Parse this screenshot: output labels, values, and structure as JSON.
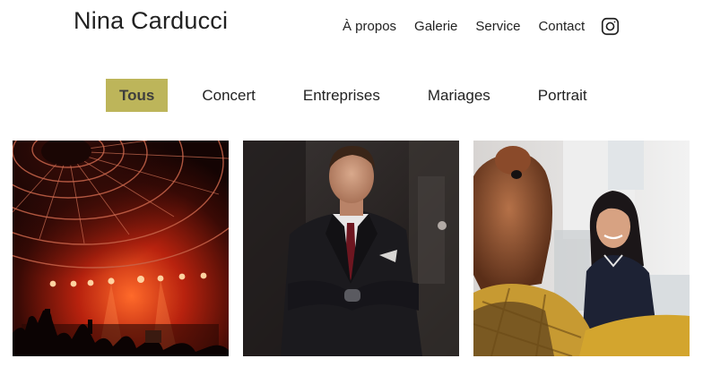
{
  "site": {
    "title": "Nina Carducci"
  },
  "nav": {
    "items": [
      "À propos",
      "Galerie",
      "Service",
      "Contact"
    ],
    "social_icon": "instagram-icon"
  },
  "filters": {
    "items": [
      "Tous",
      "Concert",
      "Entreprises",
      "Mariages",
      "Portrait"
    ],
    "active": "Tous"
  },
  "gallery": {
    "photos": [
      "concert-photo",
      "businessman-photo",
      "office-women-photo"
    ]
  },
  "colors": {
    "accent": "#bdb55a",
    "text": "#222222",
    "background": "#ffffff"
  }
}
